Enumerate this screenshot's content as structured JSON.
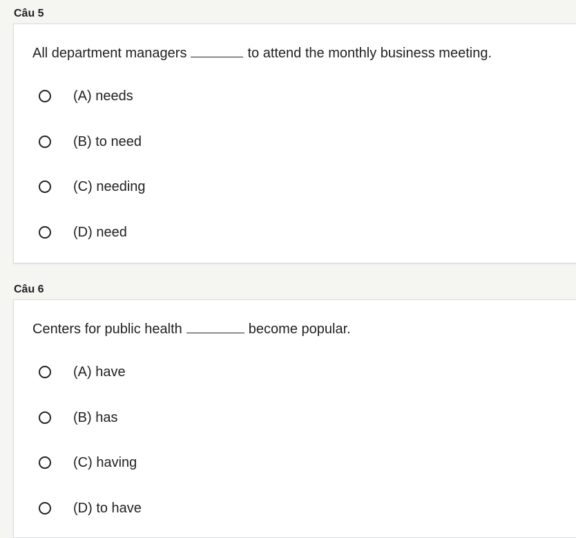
{
  "questions": [
    {
      "label": "Câu 5",
      "text_before": "All department managers",
      "text_after": "to attend the monthly business meeting.",
      "options": [
        {
          "label": "(A) needs"
        },
        {
          "label": "(B) to need"
        },
        {
          "label": "(C) needing"
        },
        {
          "label": "(D) need"
        }
      ]
    },
    {
      "label": "Câu 6",
      "text_before": "Centers for public health",
      "text_after": "become popular.",
      "options": [
        {
          "label": "(A) have"
        },
        {
          "label": "(B) has"
        },
        {
          "label": "(C) having"
        },
        {
          "label": "(D) to have"
        }
      ]
    }
  ]
}
